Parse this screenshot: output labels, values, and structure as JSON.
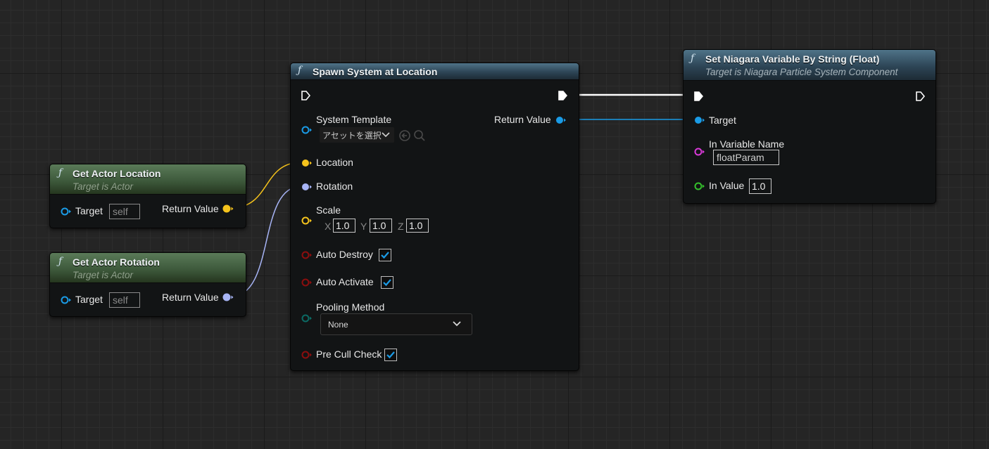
{
  "nodes": {
    "spawn": {
      "title": "Spawn System at Location",
      "icon": "function-icon",
      "pins": {
        "system_template": "System Template",
        "system_template_value": "アセットを選択",
        "return_value": "Return Value",
        "location": "Location",
        "rotation": "Rotation",
        "scale": "Scale",
        "scale_x_label": "X",
        "scale_x": "1.0",
        "scale_y_label": "Y",
        "scale_y": "1.0",
        "scale_z_label": "Z",
        "scale_z": "1.0",
        "auto_destroy": "Auto Destroy",
        "auto_destroy_checked": true,
        "auto_activate": "Auto Activate",
        "auto_activate_checked": true,
        "pooling_method": "Pooling Method",
        "pooling_method_value": "None",
        "pre_cull_check": "Pre Cull Check",
        "pre_cull_check_checked": true
      }
    },
    "set_niagara": {
      "title": "Set Niagara Variable By String (Float)",
      "subtitle": "Target is Niagara Particle System Component",
      "icon": "function-icon",
      "pins": {
        "target": "Target",
        "in_variable_name": "In Variable Name",
        "in_variable_name_value": "floatParam",
        "in_value": "In Value",
        "in_value_value": "1.0"
      }
    },
    "get_location": {
      "title": "Get Actor Location",
      "subtitle": "Target is Actor",
      "icon": "function-icon",
      "pins": {
        "target": "Target",
        "target_placeholder": "self",
        "return_value": "Return Value"
      }
    },
    "get_rotation": {
      "title": "Get Actor Rotation",
      "subtitle": "Target is Actor",
      "icon": "function-icon",
      "pins": {
        "target": "Target",
        "target_placeholder": "self",
        "return_value": "Return Value"
      }
    }
  },
  "colors": {
    "exec": "#ffffff",
    "object": "#1a9be6",
    "vector": "#f5c31c",
    "rotator": "#a7b4f5",
    "bool": "#8c0e0e",
    "name": "#d93ad9",
    "float": "#35c12c",
    "byte": "#0b6a64"
  }
}
